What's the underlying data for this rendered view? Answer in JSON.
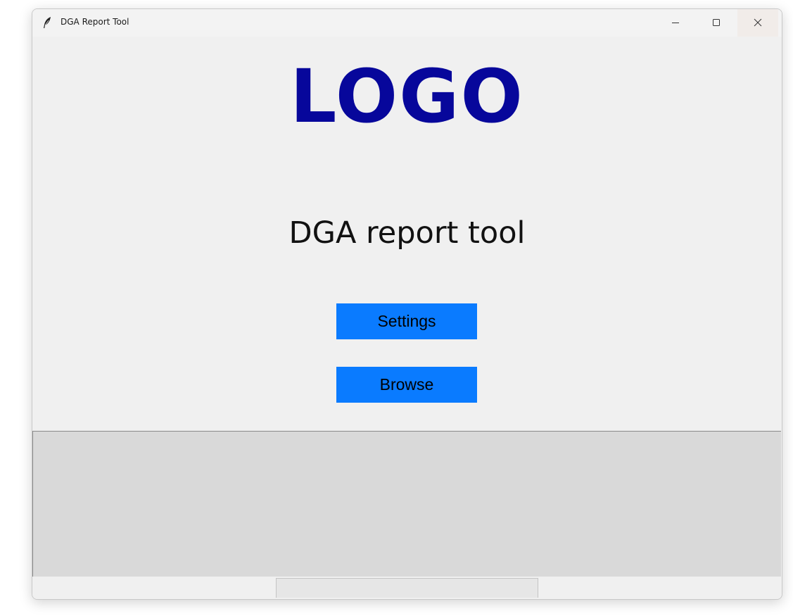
{
  "window": {
    "title": "DGA Report Tool",
    "icon": "feather-icon",
    "controls": [
      "minimize-icon",
      "maximize-icon",
      "close-icon"
    ]
  },
  "main": {
    "logo_text": "LOGO",
    "app_title": "DGA report tool",
    "buttons": {
      "settings_label": "Settings",
      "browse_label": "Browse"
    }
  },
  "colors": {
    "logo": "#07079b",
    "button_bg": "#0a7bff",
    "log_panel_bg": "#d9d9d9",
    "window_bg": "#f0f0f0"
  }
}
